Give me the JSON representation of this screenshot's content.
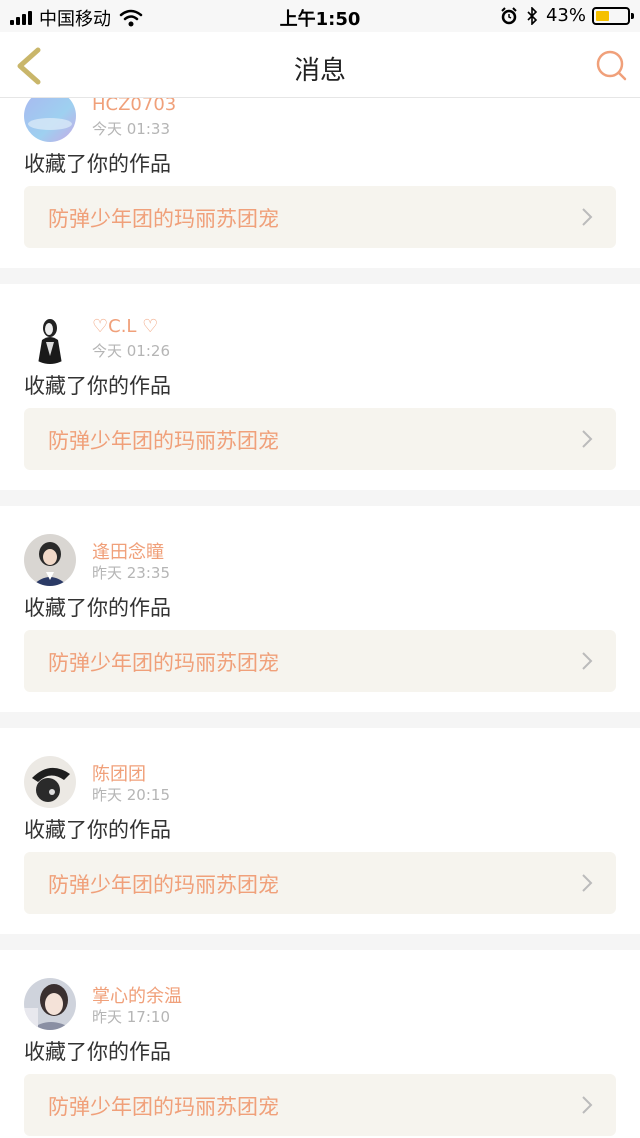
{
  "status_bar": {
    "carrier": "中国移动",
    "time": "上午1:50",
    "battery_percent": "43%",
    "battery_level": 0.43,
    "icons": [
      "signal-icon",
      "wifi-icon",
      "alarm-icon",
      "bluetooth-icon",
      "battery-icon"
    ]
  },
  "nav": {
    "title": "消息",
    "back_icon": "chevron-left-icon",
    "search_icon": "search-icon"
  },
  "colors": {
    "accent": "#f0a07a",
    "back_icon": "#c9b66a",
    "card_link_bg": "#f6f4ee",
    "separator": "#f5f5f5"
  },
  "messages": [
    {
      "username": "HCZ0703",
      "time": "今天 01:33",
      "action": "收藏了你的作品",
      "work_title": "防弹少年团的玛丽苏团宠"
    },
    {
      "username": "♡C.L ♡",
      "time": "今天 01:26",
      "action": "收藏了你的作品",
      "work_title": "防弹少年团的玛丽苏团宠"
    },
    {
      "username": "逢田念瞳",
      "time": "昨天 23:35",
      "action": "收藏了你的作品",
      "work_title": "防弹少年团的玛丽苏团宠"
    },
    {
      "username": "陈团团",
      "time": "昨天 20:15",
      "action": "收藏了你的作品",
      "work_title": "防弹少年团的玛丽苏团宠"
    },
    {
      "username": "掌心的余温",
      "time": "昨天 17:10",
      "action": "收藏了你的作品",
      "work_title": "防弹少年团的玛丽苏团宠"
    }
  ]
}
